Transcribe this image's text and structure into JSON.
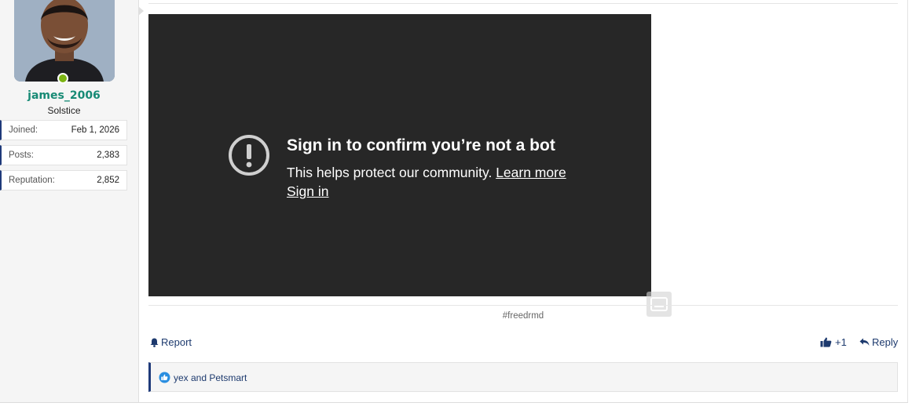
{
  "user": {
    "name": "james_2006",
    "title": "Solstice",
    "online_color": "#7cb413",
    "stats": [
      {
        "label": "Joined:",
        "value": "Feb 1, 2026"
      },
      {
        "label": "Posts:",
        "value": "2,383"
      },
      {
        "label": "Reputation:",
        "value": "2,852"
      }
    ]
  },
  "video": {
    "title": "Sign in to confirm you’re not a bot",
    "description": "This helps protect our community.",
    "learn_more": "Learn more",
    "sign_in": "Sign in",
    "icon": "alert-circle-icon",
    "background": "#272727"
  },
  "signature": {
    "hashtag": "#freedrmd"
  },
  "actions": {
    "report": "Report",
    "like_count": "+1",
    "reply": "Reply"
  },
  "reactions": {
    "text": "yex and Petsmart",
    "icon": "like-reaction-icon"
  },
  "colors": {
    "accent": "#1d3a6e",
    "username": "#178a75"
  }
}
